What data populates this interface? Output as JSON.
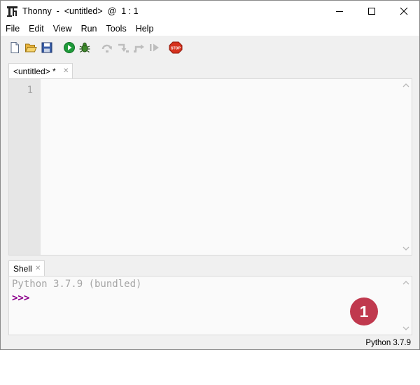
{
  "window": {
    "title": "Thonny  -  <untitled>  @  1 : 1",
    "controls": [
      "minimize",
      "maximize",
      "close"
    ]
  },
  "menu": {
    "items": [
      "File",
      "Edit",
      "View",
      "Run",
      "Tools",
      "Help"
    ]
  },
  "toolbar": {
    "buttons": [
      "new-file-icon",
      "open-file-icon",
      "save-icon",
      "run-icon",
      "debug-icon",
      "step-over-icon",
      "step-into-icon",
      "step-out-icon",
      "resume-icon",
      "stop-icon"
    ],
    "stop_label": "STOP"
  },
  "editor": {
    "tab_label": "<untitled> *",
    "line_numbers": [
      "1"
    ]
  },
  "shell": {
    "tab_label": "Shell",
    "banner": "Python 3.7.9 (bundled)",
    "prompt": ">>>"
  },
  "callout": {
    "number": "1",
    "color": "#c0394e"
  },
  "status": {
    "interpreter": "Python 3.7.9"
  },
  "colors": {
    "prompt": "#8b008b",
    "gutter": "#e6e6e6",
    "run_green": "#1f9a3a",
    "stop_red": "#d6321e"
  }
}
